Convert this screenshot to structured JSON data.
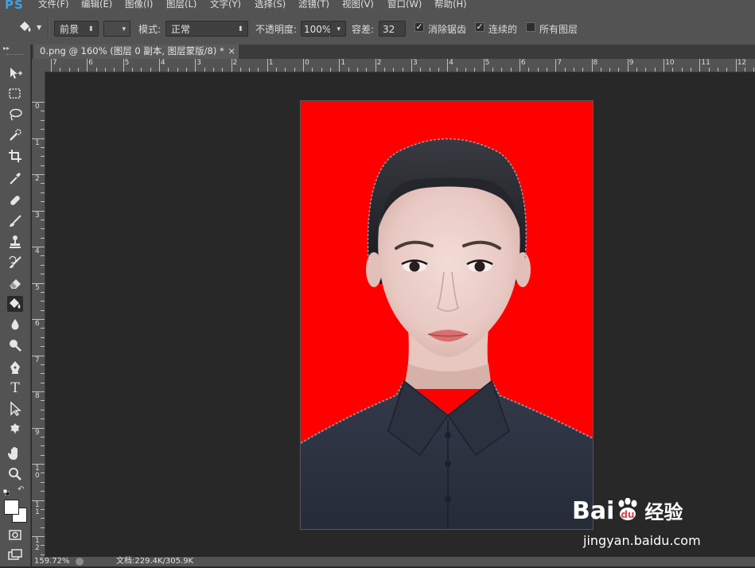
{
  "app": {
    "logo": "PS"
  },
  "menu": [
    "文件(F)",
    "编辑(E)",
    "图像(I)",
    "图层(L)",
    "文字(Y)",
    "选择(S)",
    "滤镜(T)",
    "视图(V)",
    "窗口(W)",
    "帮助(H)"
  ],
  "options": {
    "fill_source": "前景",
    "mode_label": "模式:",
    "mode_value": "正常",
    "opacity_label": "不透明度:",
    "opacity_value": "100%",
    "tolerance_label": "容差:",
    "tolerance_value": "32",
    "antialias_label": "消除锯齿",
    "antialias_checked": true,
    "contiguous_label": "连续的",
    "contiguous_checked": true,
    "all_layers_label": "所有图层",
    "all_layers_checked": false
  },
  "document_tab": {
    "title": "0.png @ 160% (图层 0 副本, 图层蒙版/8) *",
    "close": "×"
  },
  "ruler_h_labels": [
    "7",
    "6",
    "5",
    "4",
    "3",
    "2",
    "1",
    "0",
    "1",
    "2",
    "3",
    "4",
    "5",
    "6",
    "7",
    "8",
    "9",
    "10",
    "11",
    "12"
  ],
  "ruler_v_labels": [
    "0",
    "1",
    "2",
    "3",
    "4",
    "5",
    "6",
    "7",
    "8",
    "9",
    "1\n0",
    "1\n1",
    "1\n2"
  ],
  "status": {
    "zoom": "159.72%",
    "doc_info": "文档:229.4K/305.9K"
  },
  "watermark": {
    "brand": "Bai",
    "brand2": "du",
    "cn": "经验",
    "url": "jingyan.baidu.com"
  },
  "colors": {
    "background_red": "#ff0000",
    "panel": "#535353",
    "workspace": "#282828",
    "shirt": "#2f3544"
  },
  "tools": [
    "move-icon",
    "marquee-icon",
    "lasso-icon",
    "quick-select-icon",
    "crop-icon",
    "eyedropper-icon",
    "healing-brush-icon",
    "brush-icon",
    "clone-stamp-icon",
    "history-brush-icon",
    "eraser-icon",
    "paint-bucket-icon",
    "blur-icon",
    "dodge-icon",
    "pen-icon",
    "type-icon",
    "path-select-icon",
    "shape-icon",
    "hand-icon",
    "zoom-icon"
  ]
}
